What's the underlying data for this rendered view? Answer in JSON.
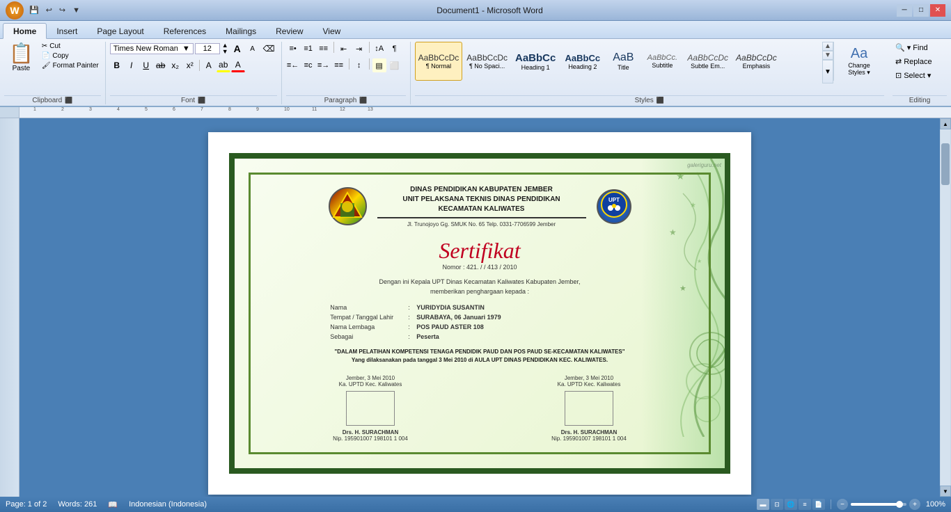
{
  "titleBar": {
    "title": "Document1 - Microsoft Word",
    "windowControls": {
      "minimize": "─",
      "maximize": "□",
      "close": "✕"
    }
  },
  "tabs": [
    {
      "id": "home",
      "label": "Home",
      "active": true
    },
    {
      "id": "insert",
      "label": "Insert",
      "active": false
    },
    {
      "id": "pageLayout",
      "label": "Page Layout",
      "active": false
    },
    {
      "id": "references",
      "label": "References",
      "active": false
    },
    {
      "id": "mailings",
      "label": "Mailings",
      "active": false
    },
    {
      "id": "review",
      "label": "Review",
      "active": false
    },
    {
      "id": "view",
      "label": "View",
      "active": false
    }
  ],
  "clipboard": {
    "groupLabel": "Clipboard",
    "pasteLabel": "Paste",
    "cutLabel": "Cut",
    "copyLabel": "Copy",
    "formatPainterLabel": "Format Painter"
  },
  "font": {
    "groupLabel": "Font",
    "fontName": "Times New Roman",
    "fontSize": "12",
    "boldLabel": "B",
    "italicLabel": "I",
    "underlineLabel": "U",
    "strikeLabel": "ab",
    "subscriptLabel": "x₂",
    "superscriptLabel": "x²",
    "highlightLabel": "ab",
    "colorLabel": "A"
  },
  "paragraph": {
    "groupLabel": "Paragraph"
  },
  "styles": {
    "groupLabel": "Styles",
    "items": [
      {
        "id": "normal",
        "preview": "AaBbCcDc",
        "label": "¶ Normal",
        "active": true
      },
      {
        "id": "noSpacing",
        "preview": "AaBbCcDc",
        "label": "¶ No Spaci..."
      },
      {
        "id": "heading1",
        "preview": "AaBbCc",
        "label": "Heading 1"
      },
      {
        "id": "heading2",
        "preview": "AaBbCc",
        "label": "Heading 2"
      },
      {
        "id": "title",
        "preview": "AaB",
        "label": "Title"
      },
      {
        "id": "subtitle",
        "preview": "AaBbCc.",
        "label": "Subtitle"
      },
      {
        "id": "subtleEmphasis",
        "preview": "AaBbCcDc",
        "label": "Subtle Em..."
      },
      {
        "id": "emphasis",
        "preview": "AaBbCcDc",
        "label": "Emphasis"
      }
    ],
    "changeStyles": "Change Styles",
    "selectLabel": "Select ▾"
  },
  "editing": {
    "groupLabel": "Editing",
    "findLabel": "▾ Find",
    "replaceLabel": "Replace",
    "selectLabel": "Select ▾"
  },
  "document": {
    "cert": {
      "orgLine1": "DINAS PENDIDIKAN KABUPATEN JEMBER",
      "orgLine2": "UNIT PELAKSANA TEKNIS DINAS PENDIDIKAN",
      "orgLine3": "KECAMATAN KALIWATES",
      "orgAddress": "Jl. Trunojoyo Gg. SMUK No. 65 Telp. 0331-7706599 Jember",
      "title": "Sertifikat",
      "nomor": "Nomor : 421.  /  / 413 / 2010",
      "bodyLine1": "Dengan ini Kepala UPT Dinas Kecamatan Kaliwates Kabupaten Jember,",
      "bodyLine2": "memberikan penghargaan kepada :",
      "namaLabel": "Nama",
      "namaValue": "YURIDYDIA SUSANTIN",
      "ttlLabel": "Tempat / Tanggal Lahir",
      "ttlValue": "SURABAYA, 06 Januari 1979",
      "lembagaLabel": "Nama Lembaga",
      "lembagaValue": "POS PAUD ASTER 108",
      "sebagaiLabel": "Sebagai",
      "sebagaiValue": "Peserta",
      "highlight": "\"DALAM PELATIHAN KOMPETENSI TENAGA PENDIDIK PAUD DAN POS PAUD SE-KECAMATAN KALIWATES\"\nYang dilaksanakan pada tanggal 3 Mei 2010 di AULA UPT DINAS PENDIDIKAN KEC. KALIWATES.",
      "sigDate1": "Jember, 3 Mei 2010",
      "sigTitle1": "Ka. UPTD Kec. Kaliwates",
      "sigName1": "Drs. H. SURACHMAN",
      "sigNip1": "Nip. 195901007 198101 1 004",
      "sigDate2": "Jember, 3 Mei 2010",
      "sigTitle2": "Ka. UPTD Kec. Kaliwates",
      "sigName2": "Drs. H. SURACHMAN",
      "sigNip2": "Nip. 195901007 198101 1 004",
      "watermark": "galeriguru.net"
    }
  },
  "statusBar": {
    "pageInfo": "Page: 1 of 2",
    "wordCount": "Words: 261",
    "language": "Indonesian (Indonesia)",
    "zoomLevel": "100%"
  }
}
